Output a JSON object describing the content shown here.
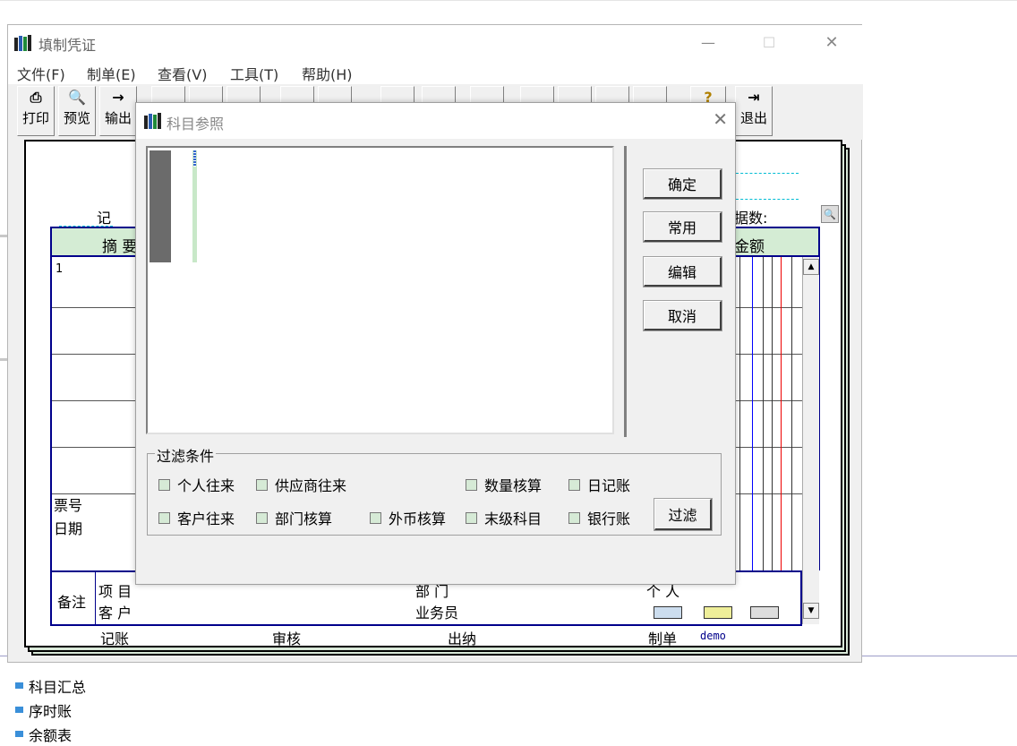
{
  "background": {
    "list_items": [
      "科目汇总",
      "序时账",
      "余额表"
    ]
  },
  "window": {
    "title": "填制凭证",
    "min_label": "—",
    "max_label": "☐",
    "close_label": "✕",
    "menu": [
      "文件(F)",
      "制单(E)",
      "查看(V)",
      "工具(T)",
      "帮助(H)"
    ],
    "toolbar": {
      "print": "打印",
      "preview": "预览",
      "export": "输出",
      "exit": "退出"
    }
  },
  "voucher": {
    "header_left": "记",
    "header_col_summary": "摘 要",
    "header_col_amount": "金额",
    "header_right_label": "据数:",
    "row1_no": "1",
    "ticket_no_label": "票号",
    "date_label": "日期",
    "remark_label": "备注",
    "project_label": "项 目",
    "customer_label": "客 户",
    "dept_label": "部 门",
    "salesman_label": "业务员",
    "person_label": "个 人",
    "bookkeeping_label": "记账",
    "review_label": "审核",
    "cashier_label": "出纳",
    "maker_label": "制单",
    "maker_value": "demo"
  },
  "dialog": {
    "title": "科目参照",
    "close_label": "✕",
    "buttons": {
      "ok": "确定",
      "common": "常用",
      "edit": "编辑",
      "cancel": "取消"
    },
    "filter": {
      "group_label": "过滤条件",
      "personal": "个人往来",
      "supplier": "供应商往来",
      "quantity": "数量核算",
      "journal": "日记账",
      "customer": "客户往来",
      "department": "部门核算",
      "foreign": "外币核算",
      "leaf": "末级科目",
      "bank": "银行账",
      "filter_button": "过滤"
    }
  }
}
